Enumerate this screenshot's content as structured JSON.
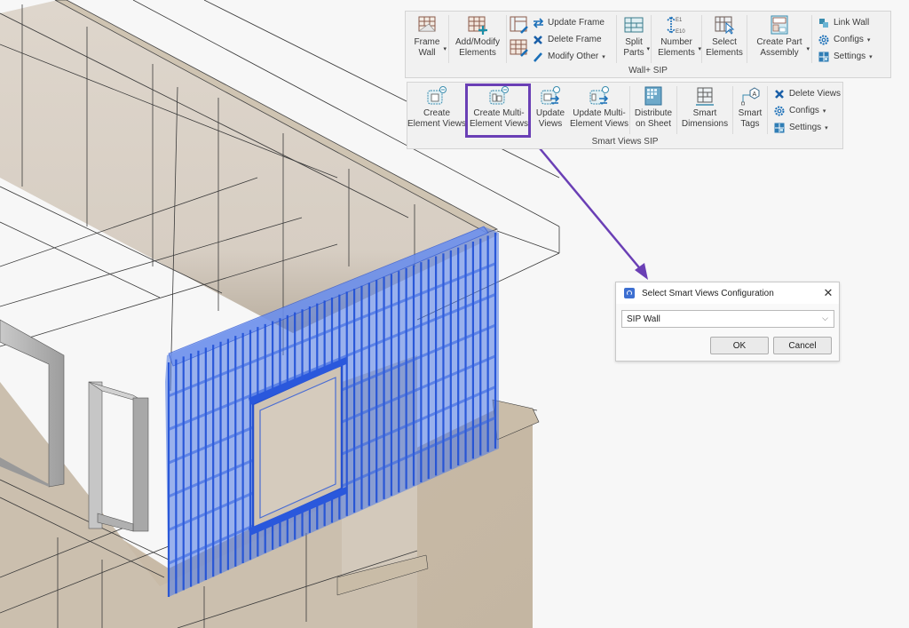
{
  "colors": {
    "accent_purple": "#6a3fb5",
    "selection_blue": "#2e5bdc",
    "wall_beige": "#d9d1c6",
    "floor_tan": "#c9bca9",
    "ribbon_bg": "#f1f1f1"
  },
  "ribbon_wall": {
    "panel_label": "Wall+ SIP",
    "buttons": [
      {
        "label": "Frame\nWall",
        "icon": "frame-wall-icon",
        "has_dropdown": true
      },
      {
        "label": "Add/Modify\nElements",
        "icon": "add-modify-elements-icon",
        "has_dropdown": false
      }
    ],
    "frame_tools": [
      {
        "label": "Update Frame",
        "icon": "update-frame-icon"
      },
      {
        "label": "Delete Frame",
        "icon": "delete-frame-icon"
      },
      {
        "label": "Modify Other",
        "icon": "modify-other-icon",
        "has_dropdown": true
      }
    ],
    "buttons2": [
      {
        "label": "Split\nParts",
        "icon": "split-parts-icon",
        "has_dropdown": true
      },
      {
        "label": "Number\nElements",
        "icon": "number-elements-icon",
        "has_dropdown": true,
        "icon_text_top": "E1",
        "icon_text_bottom": "E10"
      },
      {
        "label": "Select\nElements",
        "icon": "select-elements-icon",
        "has_dropdown": false
      },
      {
        "label": "Create Part\nAssembly",
        "icon": "create-part-assembly-icon",
        "has_dropdown": true
      }
    ],
    "side_tools": [
      {
        "label": "Link Wall",
        "icon": "link-wall-icon"
      },
      {
        "label": "Configs",
        "icon": "gear-icon",
        "has_dropdown": true
      },
      {
        "label": "Settings",
        "icon": "settings-grid-icon",
        "has_dropdown": true
      }
    ]
  },
  "ribbon_views": {
    "panel_label": "Smart Views SIP",
    "buttons": [
      {
        "label": "Create\nElement Views",
        "icon": "create-element-views-icon"
      },
      {
        "label": "Create Multi-\nElement Views",
        "icon": "create-multi-element-views-icon",
        "highlighted": true
      },
      {
        "label": "Update\nViews",
        "icon": "update-views-icon"
      },
      {
        "label": "Update Multi-\nElement Views",
        "icon": "update-multi-element-views-icon"
      },
      {
        "label": "Distribute\non Sheet",
        "icon": "distribute-on-sheet-icon"
      },
      {
        "label": "Smart\nDimensions",
        "icon": "smart-dimensions-icon"
      },
      {
        "label": "Smart\nTags",
        "icon": "smart-tags-icon",
        "icon_text": "A"
      }
    ],
    "side_tools": [
      {
        "label": "Delete Views",
        "icon": "delete-views-icon"
      },
      {
        "label": "Configs",
        "icon": "gear-icon",
        "has_dropdown": true
      },
      {
        "label": "Settings",
        "icon": "settings-grid-icon",
        "has_dropdown": true
      }
    ]
  },
  "dialog": {
    "title": "Select Smart Views Configuration",
    "close_glyph": "✕",
    "selected_value": "SIP Wall",
    "ok_label": "OK",
    "cancel_label": "Cancel"
  },
  "glyphs": {
    "caret": "▾",
    "chevron": "⌵"
  }
}
